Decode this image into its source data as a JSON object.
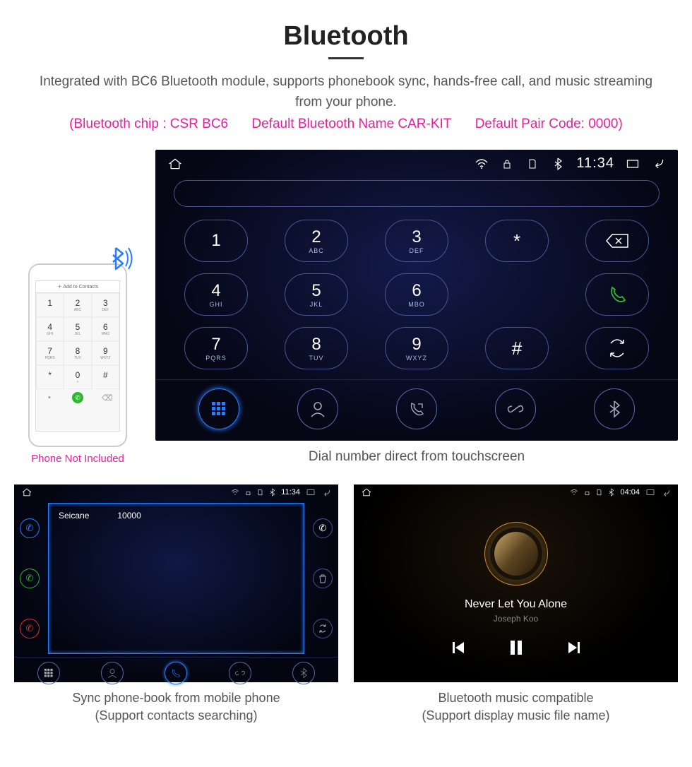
{
  "header": {
    "title": "Bluetooth",
    "description": "Integrated with BC6 Bluetooth module, supports phonebook sync, hands-free call, and music streaming from your phone.",
    "spec_chip": "(Bluetooth chip : CSR BC6",
    "spec_name": "Default Bluetooth Name CAR-KIT",
    "spec_code": "Default Pair Code: 0000)"
  },
  "phone": {
    "add_contact": "Add to Contacts",
    "note": "Phone Not Included",
    "keys": [
      {
        "n": "1",
        "s": ""
      },
      {
        "n": "2",
        "s": "ABC"
      },
      {
        "n": "3",
        "s": "DEF"
      },
      {
        "n": "4",
        "s": "GHI"
      },
      {
        "n": "5",
        "s": "JKL"
      },
      {
        "n": "6",
        "s": "MNO"
      },
      {
        "n": "7",
        "s": "PQRS"
      },
      {
        "n": "8",
        "s": "TUV"
      },
      {
        "n": "9",
        "s": "WXYZ"
      },
      {
        "n": "*",
        "s": ""
      },
      {
        "n": "0",
        "s": "+"
      },
      {
        "n": "#",
        "s": ""
      }
    ]
  },
  "dialer": {
    "status_time": "11:34",
    "keypad": [
      {
        "n": "1",
        "s": ""
      },
      {
        "n": "2",
        "s": "ABC"
      },
      {
        "n": "3",
        "s": "DEF"
      },
      {
        "n": "*",
        "s": ""
      },
      {
        "icon": "backspace"
      },
      {
        "n": "4",
        "s": "GHI"
      },
      {
        "n": "5",
        "s": "JKL"
      },
      {
        "n": "6",
        "s": "MBO"
      },
      {
        "n": "",
        "s": ""
      },
      {
        "icon": "call"
      },
      {
        "n": "7",
        "s": "PQRS"
      },
      {
        "n": "8",
        "s": "TUV"
      },
      {
        "n": "9",
        "s": "WXYZ"
      },
      {
        "n": "#",
        "s": ""
      },
      {
        "icon": "swap"
      }
    ],
    "caption": "Dial number direct from touchscreen"
  },
  "phonebook": {
    "status_time": "11:34",
    "contact_name": "Seicane",
    "contact_number": "10000",
    "caption_l1": "Sync phone-book from mobile phone",
    "caption_l2": "(Support contacts searching)"
  },
  "music": {
    "status_time": "04:04",
    "track": "Never Let You Alone",
    "artist": "Joseph Koo",
    "caption_l1": "Bluetooth music compatible",
    "caption_l2": "(Support display music file name)"
  }
}
